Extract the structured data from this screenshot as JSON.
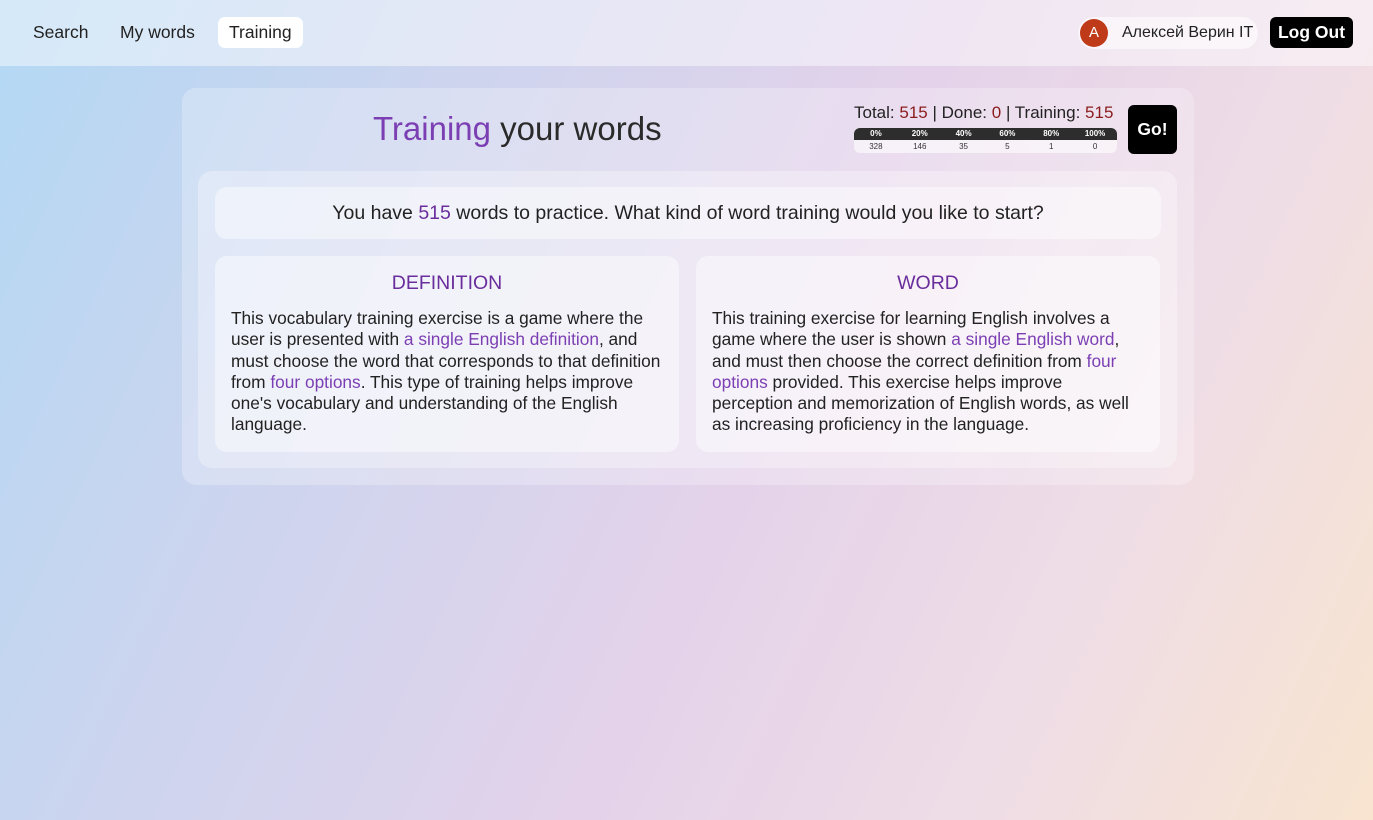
{
  "nav": {
    "items": [
      {
        "label": "Search",
        "active": false
      },
      {
        "label": "My words",
        "active": false
      },
      {
        "label": "Training",
        "active": true
      }
    ]
  },
  "user": {
    "initial": "A",
    "name": "Алексей Верин IT",
    "avatar_color": "#bf3a18"
  },
  "logout_label": "Log Out",
  "header": {
    "title_accent": "Training",
    "title_rest": "your words",
    "stats": {
      "total_label": "Total:",
      "total": "515",
      "done_label": "Done:",
      "done": "0",
      "training_label": "Training:",
      "training": "515",
      "separator": "|"
    },
    "distribution": {
      "labels": [
        "0%",
        "20%",
        "40%",
        "60%",
        "80%",
        "100%"
      ],
      "counts": [
        "328",
        "146",
        "35",
        "5",
        "1",
        "0"
      ]
    },
    "go_label": "Go!"
  },
  "prompt": {
    "before": "You have",
    "count": "515",
    "after": "words to practice. What kind of word training would you like to start?"
  },
  "cards": [
    {
      "title": "DEFINITION",
      "t1": "This vocabulary training exercise is a game where the user is presented with ",
      "h1": "a single English definition",
      "t2": ", and must choose the word that corresponds to that definition from ",
      "h2": "four options",
      "t3": ". This type of training helps improve one's vocabulary and understanding of the English language."
    },
    {
      "title": "WORD",
      "t1": "This training exercise for learning English involves a game where the user is shown ",
      "h1": "a single English word",
      "t2": ", and must then choose the correct definition from ",
      "h2": "four options",
      "t3": " provided. This exercise helps improve perception and memorization of English words, as well as increasing proficiency in the language."
    }
  ],
  "colors": {
    "accent": "#7b3fb3",
    "stat_number": "#8a1c1c",
    "button": "#000000"
  }
}
